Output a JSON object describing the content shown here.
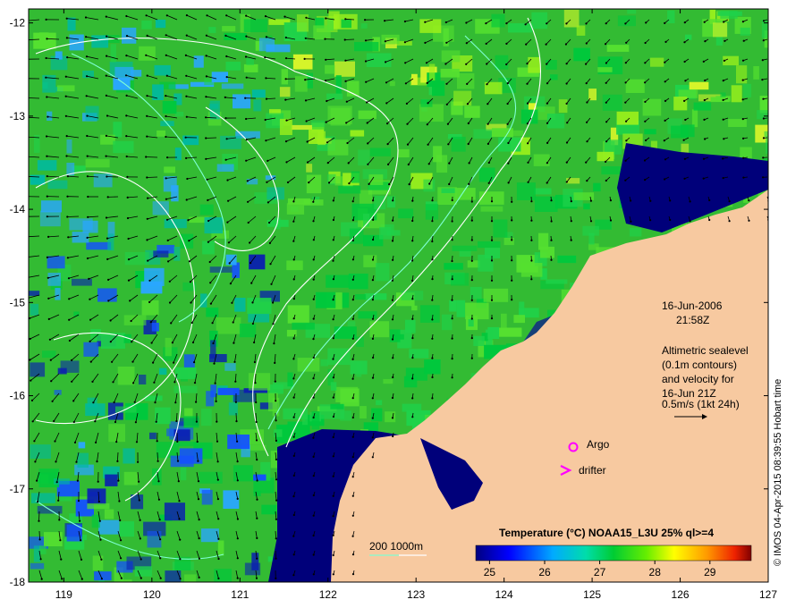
{
  "map": {
    "lat_ticks": [
      "-12",
      "-13",
      "-14",
      "-15",
      "-16",
      "-17",
      "-18"
    ],
    "lon_ticks": [
      "119",
      "120",
      "121",
      "122",
      "123",
      "124",
      "125",
      "126",
      "127"
    ],
    "lat_range": [
      -18,
      -11.85
    ],
    "lon_range": [
      118.6,
      127.0
    ]
  },
  "annotation": {
    "date": "16-Jun-2006",
    "time": "21:58Z",
    "altimetric_lines": [
      "Altimetric sealevel",
      "(0.1m contours)",
      "and velocity for",
      "16-Jun 21Z",
      "0.5m/s (1kt 24h)"
    ]
  },
  "legend": {
    "argo_label": "Argo",
    "drifter_label": "drifter",
    "depth_label": "200  1000m",
    "colorbar_title": "Temperature (°C) NOAA15_L3U 25% ql>=4",
    "colorbar_ticks": [
      "25",
      "26",
      "27",
      "28",
      "29"
    ],
    "colorbar_range": [
      24.75,
      29.75
    ]
  },
  "credit": "© IMOS 04-Apr-2015 08:39:55 Hobart time",
  "colors": {
    "land": "#f7c9a0",
    "argo": "#ff00ff",
    "drifter": "#ff00ff",
    "contour_200m": "#7fffd4",
    "contour_1000m": "#ffffff",
    "cold_water": "#00007a"
  }
}
